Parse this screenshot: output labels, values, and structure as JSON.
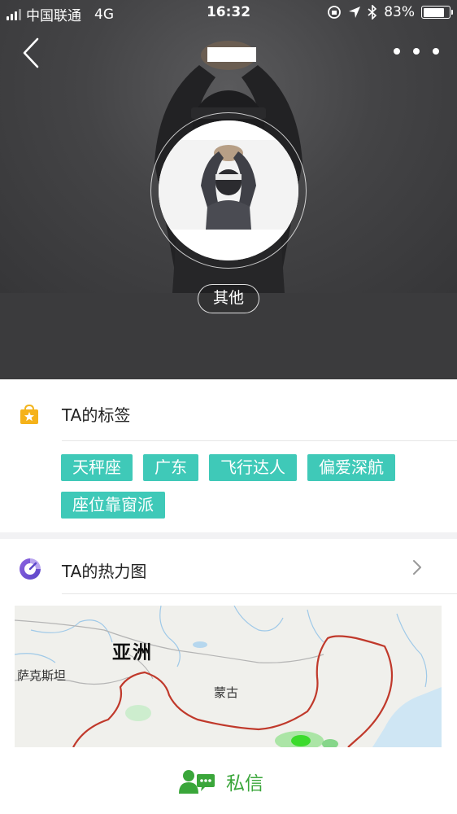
{
  "status_bar": {
    "carrier": "中国联通",
    "network": "4G",
    "time": "16:32",
    "battery": "83%",
    "battery_level": 0.83
  },
  "profile": {
    "tag_pill": "其他"
  },
  "tags_section": {
    "title": "TA的标签",
    "tags": [
      "天秤座",
      "广东",
      "飞行达人",
      "偏爱深航",
      "座位靠窗派"
    ],
    "tag_color": "#3fc9b8"
  },
  "heatmap_section": {
    "title": "TA的热力图",
    "map_labels": {
      "asia": "亚洲",
      "kazakhstan": "萨克斯坦",
      "mongolia": "蒙古"
    }
  },
  "bottom_bar": {
    "message_label": "私信",
    "accent": "#3aa63a"
  },
  "icons": [
    "back-icon",
    "more-icon",
    "shopping-bag-icon",
    "heat-gauge-icon",
    "chevron-right-icon",
    "chat-icon"
  ]
}
